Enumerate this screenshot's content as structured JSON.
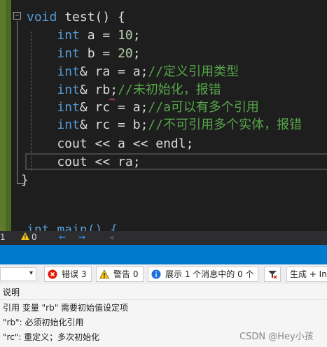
{
  "editor": {
    "lines": [
      {
        "parts": [
          {
            "t": "void",
            "c": "kw"
          },
          {
            "t": " test() {",
            "c": "ident"
          }
        ]
      },
      {
        "parts": [
          {
            "t": "    ",
            "c": "ident"
          },
          {
            "t": "int",
            "c": "kw"
          },
          {
            "t": " a = ",
            "c": "ident"
          },
          {
            "t": "10",
            "c": "num"
          },
          {
            "t": ";",
            "c": "ident"
          }
        ]
      },
      {
        "parts": [
          {
            "t": "    ",
            "c": "ident"
          },
          {
            "t": "int",
            "c": "kw"
          },
          {
            "t": " b = ",
            "c": "ident"
          },
          {
            "t": "20",
            "c": "num"
          },
          {
            "t": ";",
            "c": "ident"
          }
        ]
      },
      {
        "parts": [
          {
            "t": "    ",
            "c": "ident"
          },
          {
            "t": "int",
            "c": "kw"
          },
          {
            "t": "& ra = a;",
            "c": "ident"
          },
          {
            "t": "//定义引用类型",
            "c": "cm"
          }
        ]
      },
      {
        "parts": [
          {
            "t": "    ",
            "c": "ident"
          },
          {
            "t": "int",
            "c": "kw"
          },
          {
            "t": "& rb;",
            "c": "ident"
          },
          {
            "t": "//未初始化，报错",
            "c": "cm"
          }
        ]
      },
      {
        "parts": [
          {
            "t": "    ",
            "c": "ident"
          },
          {
            "t": "int",
            "c": "kw"
          },
          {
            "t": "& rc = a;",
            "c": "ident"
          },
          {
            "t": "//a可以有多个引用",
            "c": "cm"
          }
        ]
      },
      {
        "parts": [
          {
            "t": "    ",
            "c": "ident"
          },
          {
            "t": "int",
            "c": "kw"
          },
          {
            "t": "& rc = b;",
            "c": "ident"
          },
          {
            "t": "//不可引用多个实体，报错",
            "c": "cm"
          }
        ]
      },
      {
        "parts": [
          {
            "t": "    cout << a << endl;",
            "c": "ident"
          }
        ]
      },
      {
        "parts": [
          {
            "t": "    cout << ra;",
            "c": "ident"
          }
        ]
      },
      {
        "parts": [
          {
            "t": "}",
            "c": "ident"
          }
        ]
      }
    ],
    "next_line": "int main() {",
    "collapse_glyph": "−"
  },
  "statusbar": {
    "errors_count": "1",
    "warnings_count": "0",
    "nav_back": "←",
    "nav_forward": "→"
  },
  "error_list": {
    "errors_label": "错误 3",
    "warnings_label": "警告 0",
    "messages_label": "展示 1 个消息中的 0 个",
    "build_label": "生成 + Int",
    "column_header": "说明",
    "rows": [
      "引用 变量 \"rb\" 需要初始值设定项",
      "\"rb\": 必须初始化引用",
      "\"rc\": 重定义；多次初始化"
    ]
  },
  "watermark": "CSDN @Hey小孩",
  "colors": {
    "keyword": "#569cd6",
    "number": "#b5cea8",
    "comment": "#57a64a",
    "accent": "#007acc"
  }
}
